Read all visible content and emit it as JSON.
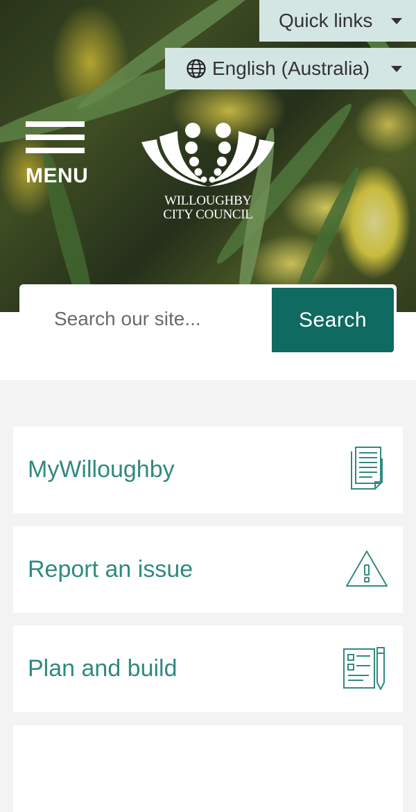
{
  "header": {
    "quick_links_label": "Quick links",
    "language_label": "English (Australia)",
    "menu_label": "MENU",
    "logo": {
      "line1": "WILLOUGHBY",
      "line2": "CITY COUNCIL"
    }
  },
  "search": {
    "placeholder": "Search our site...",
    "button_label": "Search"
  },
  "cards": [
    {
      "label": "MyWilloughby",
      "icon": "document-icon"
    },
    {
      "label": "Report an issue",
      "icon": "warning-icon"
    },
    {
      "label": "Plan and build",
      "icon": "plan-form-pencil-icon"
    }
  ],
  "colors": {
    "accent": "#0f6a61",
    "card_text": "#2f8a80",
    "dropdown_bg": "#d4e6e3",
    "page_bg": "#f3f3f3"
  }
}
